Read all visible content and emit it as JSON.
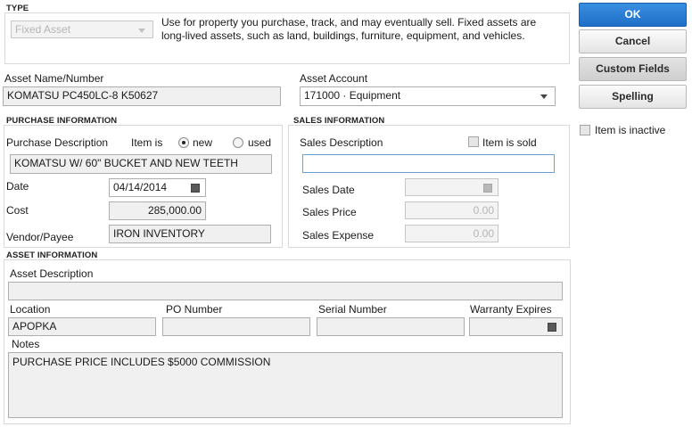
{
  "type_section": {
    "title": "TYPE",
    "selected": "Fixed Asset",
    "description": "Use for property you purchase, track, and may eventually sell.  Fixed assets are long-lived assets, such as land, buildings, furniture, equipment, and vehicles."
  },
  "asset_name": {
    "label": "Asset Name/Number",
    "value": "KOMATSU PC450LC-8 K50627"
  },
  "asset_account": {
    "label": "Asset Account",
    "value": "171000 · Equipment"
  },
  "purchase": {
    "title": "PURCHASE INFORMATION",
    "description_label": "Purchase Description",
    "item_is_label": "Item is",
    "new_label": "new",
    "used_label": "used",
    "condition_selected": "new",
    "description_value": "KOMATSU W/ 60\" BUCKET AND NEW TEETH",
    "date_label": "Date",
    "date_value": "04/14/2014",
    "cost_label": "Cost",
    "cost_value": "285,000.00",
    "vendor_label": "Vendor/Payee",
    "vendor_value": "IRON INVENTORY"
  },
  "sales": {
    "title": "SALES INFORMATION",
    "description_label": "Sales Description",
    "item_sold_label": "Item is sold",
    "item_sold_checked": false,
    "description_value": "",
    "date_label": "Sales Date",
    "date_value": "",
    "price_label": "Sales Price",
    "price_value": "0.00",
    "expense_label": "Sales Expense",
    "expense_value": "0.00"
  },
  "asset_info": {
    "title": "ASSET INFORMATION",
    "description_label": "Asset Description",
    "description_value": "",
    "location_label": "Location",
    "location_value": "APOPKA",
    "po_label": "PO Number",
    "po_value": "",
    "serial_label": "Serial Number",
    "serial_value": "",
    "warranty_label": "Warranty Expires",
    "warranty_value": "",
    "notes_label": "Notes",
    "notes_value": "PURCHASE PRICE INCLUDES $5000 COMMISSION"
  },
  "buttons": {
    "ok": "OK",
    "cancel": "Cancel",
    "custom_fields": "Custom Fields",
    "spelling": "Spelling"
  },
  "inactive": {
    "label": "Item is inactive",
    "checked": false
  },
  "colors": {
    "primary_button": "#2a7fd6",
    "field_bg": "#f0f0f0",
    "focus_border": "#6f9fd0"
  }
}
